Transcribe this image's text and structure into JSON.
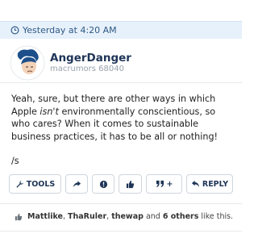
{
  "post": {
    "timestamp": "Yesterday at 4:20 AM",
    "author": {
      "name": "AngerDanger",
      "title": "macrumors 68040"
    },
    "body": {
      "line1_before": "Yeah, sure, but there are other ways in which Apple ",
      "line1_em": "isn't",
      "line1_after": " environmentally conscientious, so who cares? When it comes to sustainable business practices, it has to be all or nothing!",
      "line2": "/s"
    }
  },
  "actions": {
    "tools_label": "TOOLS",
    "multiquote_label": "+",
    "reply_label": "REPLY"
  },
  "likes": {
    "user1": "Mattlike",
    "sep1": ", ",
    "user2": "ThaRuler",
    "sep2": ", ",
    "user3": "thewap",
    "and_text": " and ",
    "others": "6 others",
    "suffix": " like this."
  },
  "colors": {
    "header_bg": "#e7f1fb",
    "accent": "#1f3557",
    "time_text": "#2f5a86"
  },
  "icons": [
    "clock-icon",
    "wrench-icon",
    "share-icon",
    "report-icon",
    "thumbs-up-icon",
    "quote-icon",
    "reply-icon"
  ]
}
